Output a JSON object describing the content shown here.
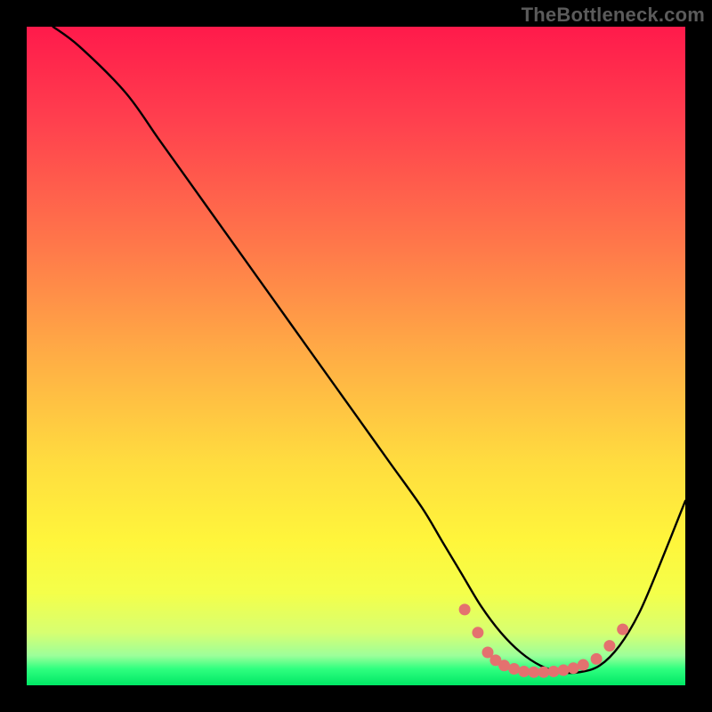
{
  "watermark": "TheBottleneck.com",
  "chart_data": {
    "type": "line",
    "title": "",
    "xlabel": "",
    "ylabel": "",
    "xlim": [
      0,
      100
    ],
    "ylim": [
      0,
      100
    ],
    "gradient_stops": [
      {
        "offset": 0,
        "color": "#ff1a4b"
      },
      {
        "offset": 0.14,
        "color": "#ff3f4e"
      },
      {
        "offset": 0.34,
        "color": "#ff7a4a"
      },
      {
        "offset": 0.5,
        "color": "#ffad45"
      },
      {
        "offset": 0.66,
        "color": "#ffdc3f"
      },
      {
        "offset": 0.78,
        "color": "#fff53b"
      },
      {
        "offset": 0.86,
        "color": "#f4ff4a"
      },
      {
        "offset": 0.92,
        "color": "#d7ff71"
      },
      {
        "offset": 0.955,
        "color": "#9cff9a"
      },
      {
        "offset": 0.975,
        "color": "#2fff7f"
      },
      {
        "offset": 1.0,
        "color": "#00e765"
      }
    ],
    "series": [
      {
        "name": "bottleneck-curve",
        "x": [
          4,
          8,
          15,
          20,
          25,
          30,
          35,
          40,
          45,
          50,
          55,
          60,
          63,
          66,
          69,
          72,
          75,
          78,
          81,
          84,
          87,
          90,
          93,
          96,
          100
        ],
        "y": [
          100,
          97,
          90,
          83,
          76,
          69,
          62,
          55,
          48,
          41,
          34,
          27,
          22,
          17,
          12,
          8,
          5,
          3,
          2,
          2,
          3,
          6,
          11,
          18,
          28
        ]
      }
    ],
    "markers": {
      "name": "highlight-dots",
      "color": "#e4716f",
      "radius": 6.5,
      "points": [
        {
          "x": 66.5,
          "y": 11.5
        },
        {
          "x": 68.5,
          "y": 8.0
        },
        {
          "x": 70.0,
          "y": 5.0
        },
        {
          "x": 71.2,
          "y": 3.8
        },
        {
          "x": 72.5,
          "y": 3.0
        },
        {
          "x": 74.0,
          "y": 2.5
        },
        {
          "x": 75.5,
          "y": 2.1
        },
        {
          "x": 77.0,
          "y": 2.0
        },
        {
          "x": 78.5,
          "y": 2.0
        },
        {
          "x": 80.0,
          "y": 2.1
        },
        {
          "x": 81.5,
          "y": 2.3
        },
        {
          "x": 83.0,
          "y": 2.6
        },
        {
          "x": 84.5,
          "y": 3.1
        },
        {
          "x": 86.5,
          "y": 4.0
        },
        {
          "x": 88.5,
          "y": 6.0
        },
        {
          "x": 90.5,
          "y": 8.5
        }
      ]
    }
  }
}
